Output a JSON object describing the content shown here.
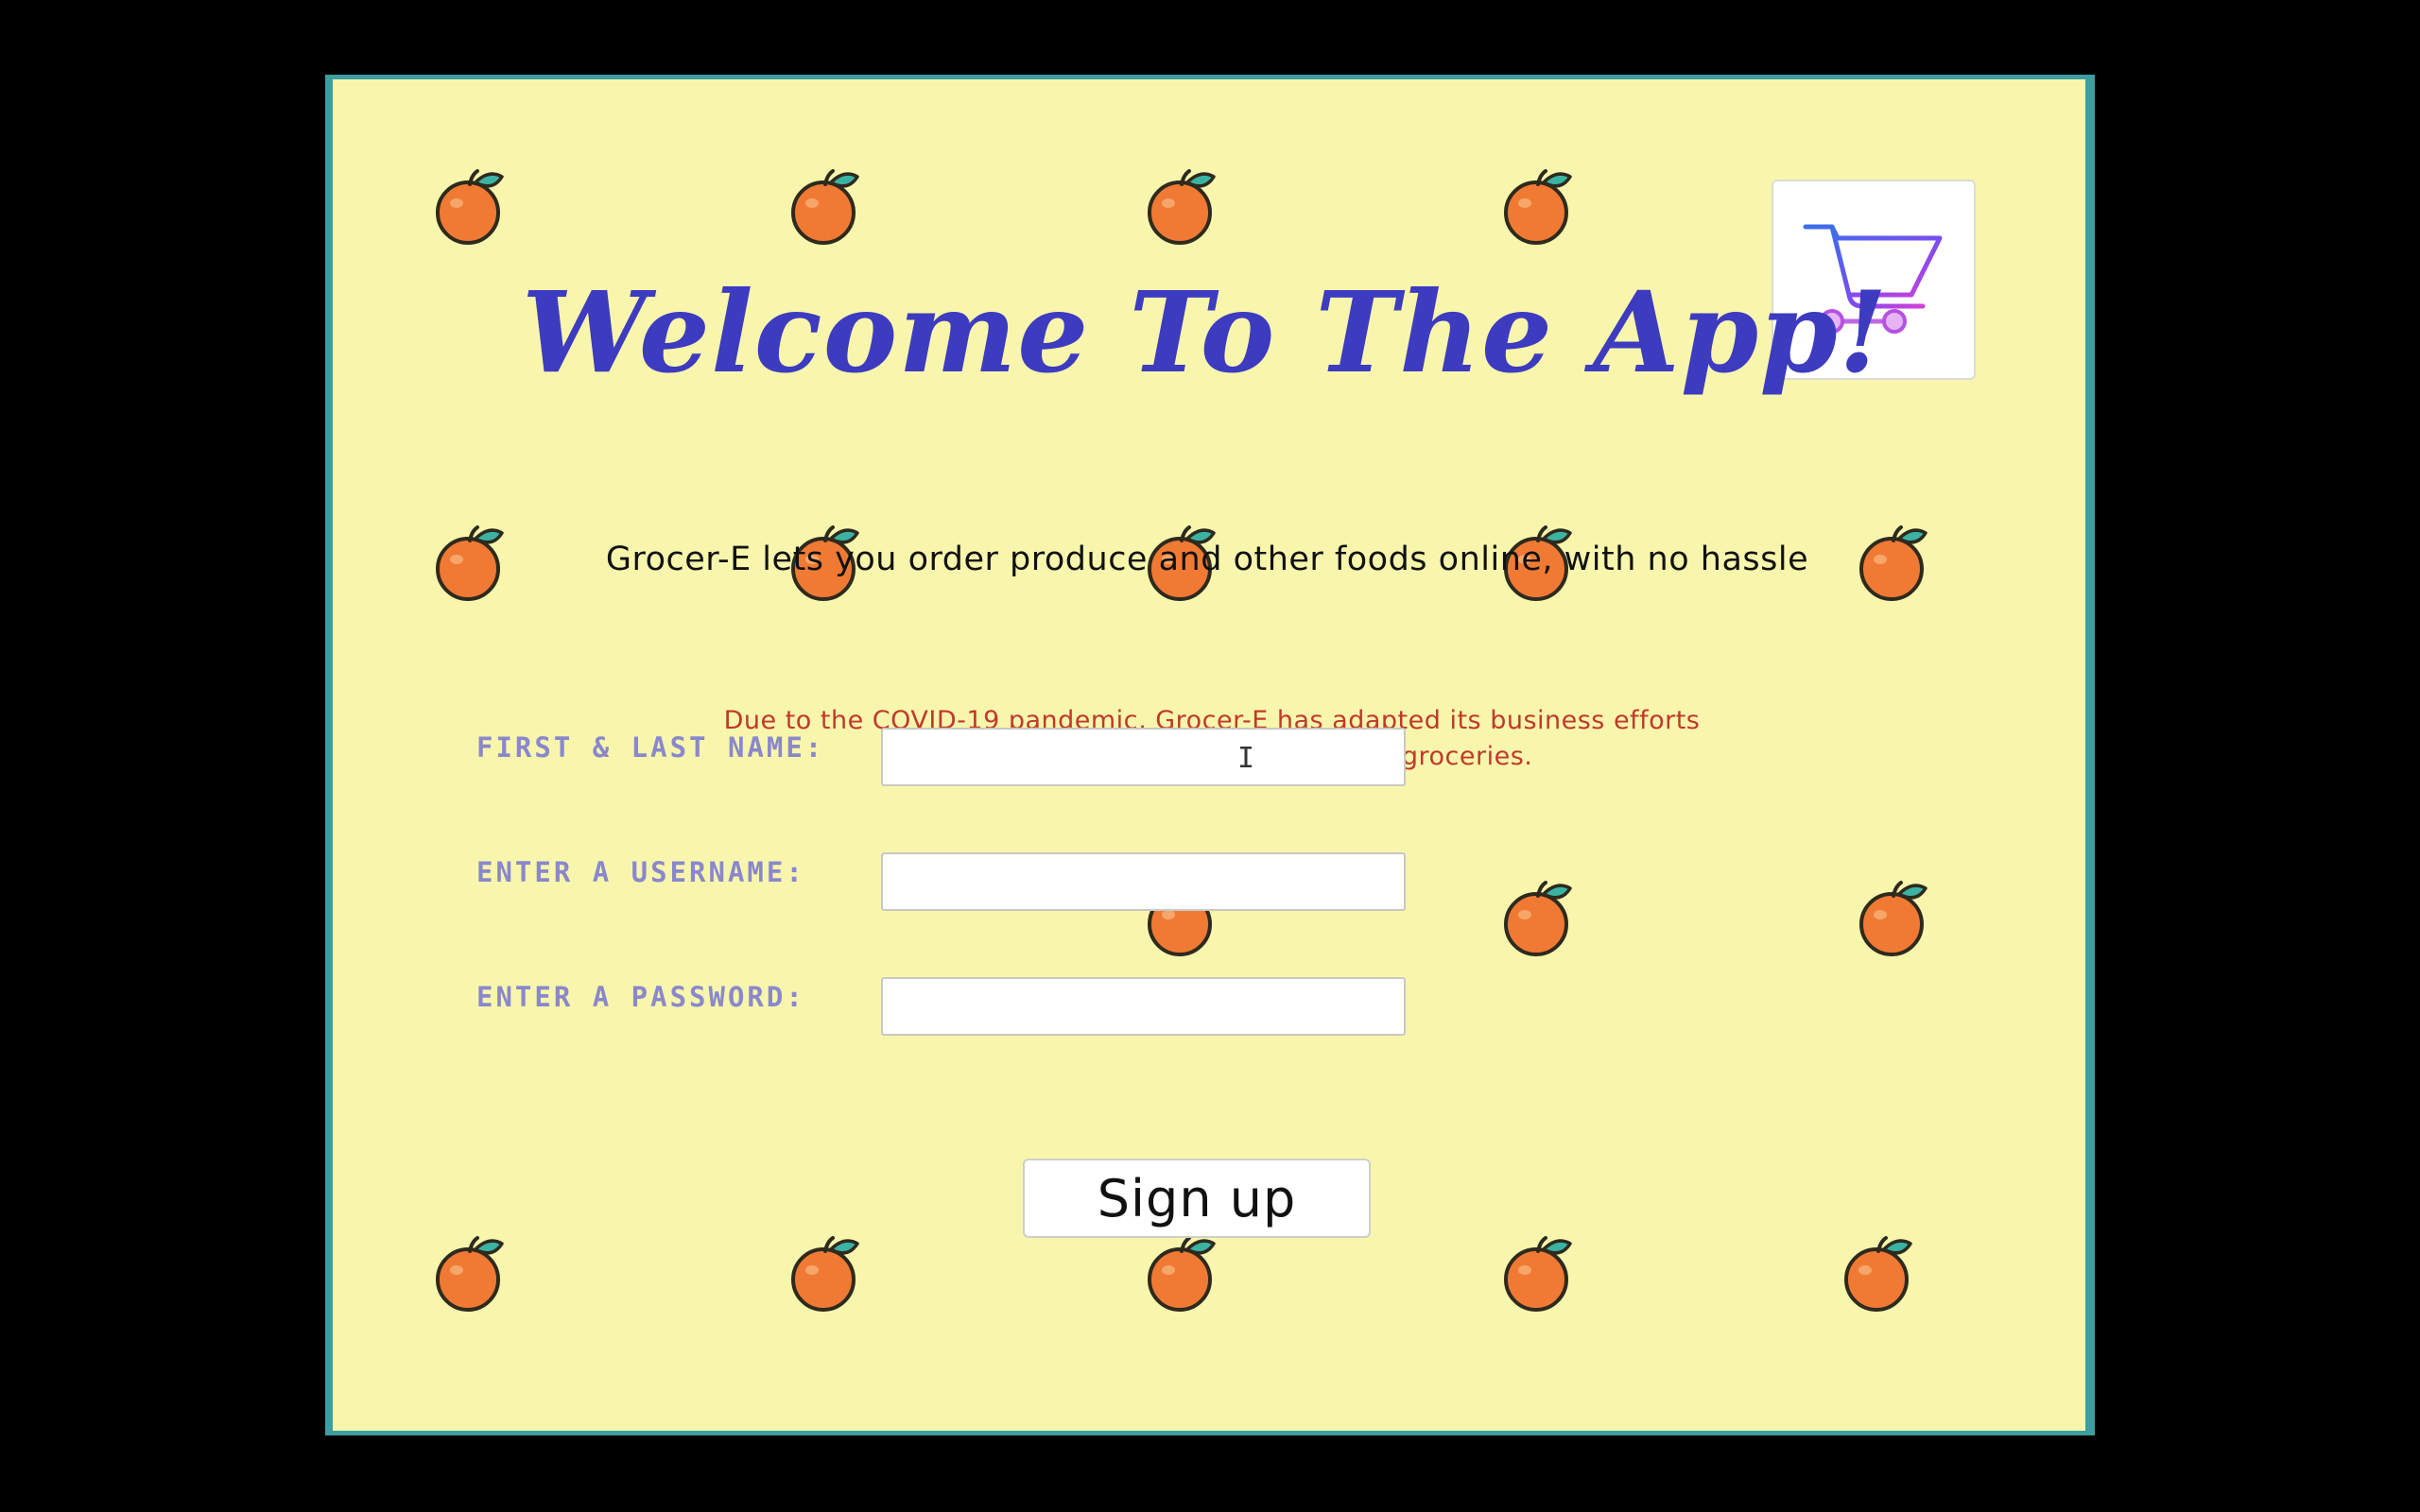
{
  "header": {
    "title": "Welcome To The App!",
    "cart_icon": "shopping-cart-icon"
  },
  "tagline": "Grocer-E lets you order produce and other foods online, with no hassle",
  "notice": {
    "line1": "Due to the COVID-19 pandemic, Grocer-E has adapted its business efforts",
    "line2": "to encourage communal aid in buying groceries."
  },
  "form": {
    "name_label": "FIRST & LAST NAME:",
    "name_value": "",
    "username_label": "ENTER A USERNAME:",
    "username_value": "",
    "password_label": "ENTER A PASSWORD:",
    "password_value": "",
    "submit_label": "Sign up"
  },
  "background": {
    "decoration_icon": "orange-icon"
  },
  "colors": {
    "background": "#f8f6ac",
    "frame": "#3d9ea0",
    "title": "#3d3bbf",
    "notice": "#c0392b",
    "labels": "#8a88cc",
    "cart_accent": "#7b4cf0"
  }
}
